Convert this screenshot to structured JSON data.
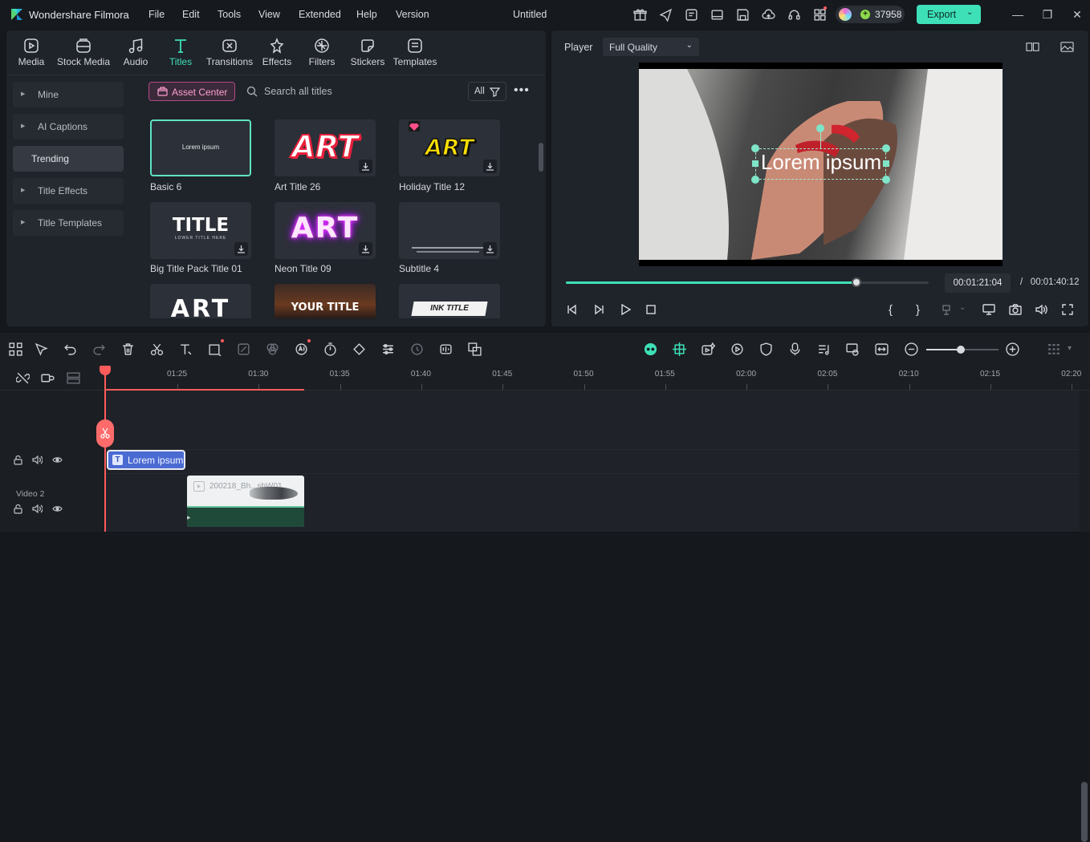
{
  "app": {
    "name": "Wondershare Filmora",
    "project_title": "Untitled",
    "menu": [
      "File",
      "Edit",
      "Tools",
      "View",
      "Extended",
      "Help",
      "Version"
    ],
    "credits": "37958",
    "export_label": "Export",
    "accent": "#3ee0b8"
  },
  "tool_tabs": [
    {
      "label": "Media",
      "icon": "media-icon"
    },
    {
      "label": "Stock Media",
      "icon": "stock-media-icon"
    },
    {
      "label": "Audio",
      "icon": "audio-icon"
    },
    {
      "label": "Titles",
      "icon": "titles-icon",
      "active": true
    },
    {
      "label": "Transitions",
      "icon": "transitions-icon"
    },
    {
      "label": "Effects",
      "icon": "effects-icon"
    },
    {
      "label": "Filters",
      "icon": "filters-icon"
    },
    {
      "label": "Stickers",
      "icon": "stickers-icon"
    },
    {
      "label": "Templates",
      "icon": "templates-icon"
    }
  ],
  "categories": [
    {
      "label": "Mine"
    },
    {
      "label": "AI Captions"
    },
    {
      "label": "Trending",
      "active": true
    },
    {
      "label": "Title Effects"
    },
    {
      "label": "Title Templates"
    }
  ],
  "browser": {
    "asset_center": "Asset Center",
    "search_placeholder": "Search all titles",
    "filter": "All"
  },
  "cards": [
    {
      "label": "Basic 6",
      "thumb_text": "Lorem ipsum"
    },
    {
      "label": "Art Title 26",
      "thumb_text": "ART"
    },
    {
      "label": "Holiday Title 12",
      "thumb_text": "ART"
    },
    {
      "label": "Big Title Pack Title 01",
      "thumb_text": "TITLE",
      "thumb_sub": "LOWER TITLE HERE"
    },
    {
      "label": "Neon Title 09",
      "thumb_text": "ART"
    },
    {
      "label": "Subtitle 4",
      "thumb_text": ""
    },
    {
      "label": "",
      "thumb_text": "ART"
    },
    {
      "label": "",
      "thumb_text": "YOUR TITLE"
    },
    {
      "label": "",
      "thumb_text": "INK TITLE"
    }
  ],
  "player": {
    "label": "Player",
    "quality": "Full Quality",
    "overlay_text": "Lorem ipsum",
    "current_time": "00:01:21:04",
    "separator": "/",
    "total_time": "00:01:40:12",
    "progress": 0.8
  },
  "timeline": {
    "ruler": [
      "01:25",
      "01:30",
      "01:35",
      "01:40",
      "01:45",
      "01:50",
      "01:55",
      "02:00",
      "02:05",
      "02:10",
      "02:15",
      "02:20"
    ],
    "track_label": "Video 2",
    "title_clip": "Lorem ipsum",
    "video_clip": "200218_Bh...shW01",
    "zoom": 0.48
  }
}
